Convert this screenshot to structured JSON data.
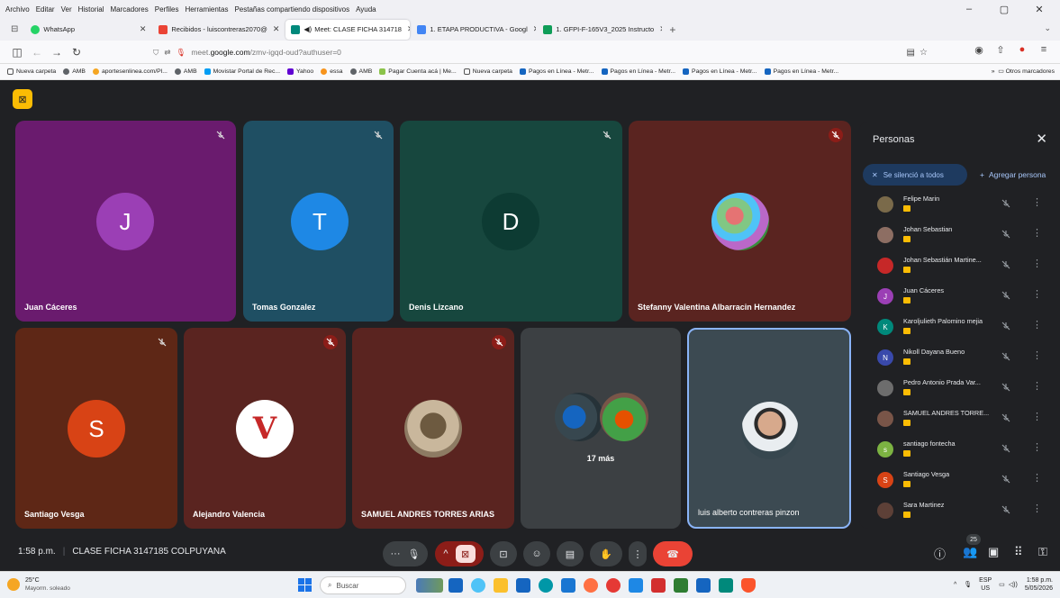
{
  "menubar": [
    "Archivo",
    "Editar",
    "Ver",
    "Historial",
    "Marcadores",
    "Perfiles",
    "Herramientas",
    "Pestañas compartiendo dispositivos",
    "Ayuda"
  ],
  "tabs": [
    {
      "label": "WhatsApp",
      "icon": "whatsapp-icon",
      "color": "#25d366",
      "active": false
    },
    {
      "label": "Recibidos - luiscontreras2070@",
      "icon": "gmail-icon",
      "color": "#ea4335",
      "active": false
    },
    {
      "label": "Meet: CLASE FICHA 314718",
      "icon": "meet-icon",
      "color": "#00897b",
      "active": true
    },
    {
      "label": "1. ETAPA PRODUCTIVA - Googl",
      "icon": "drive-icon",
      "color": "#4285f4",
      "active": false
    },
    {
      "label": "1. GFPI-F-165V3_2025 Instructo",
      "icon": "sheets-icon",
      "color": "#0f9d58",
      "active": false
    }
  ],
  "url": {
    "prefix": "meet.",
    "host": "google.com",
    "path": "/zmv-igqd-oud?authuser=0"
  },
  "bookmarks": [
    "Nueva carpeta",
    "AMB",
    "aportesenlinea.com/Pl...",
    "AMB",
    "Movistar Portal de Rec...",
    "Yahoo",
    "essa",
    "AMB",
    "Pagar Cuenta acá | Me...",
    "Nueva carpeta",
    "Pagos en Línea - Metr...",
    "Pagos en Línea - Metr...",
    "Pagos en Línea - Metr...",
    "Pagos en Línea - Metr..."
  ],
  "other_bookmarks": "Otros marcadores",
  "tiles": [
    {
      "name": "Juan Cáceres",
      "initial": "J",
      "bg": "#6a1b6e",
      "avatar": "#9b3fb5",
      "muted": true
    },
    {
      "name": "Tomas Gonzalez",
      "initial": "T",
      "bg": "#1f4f63",
      "avatar": "#1e88e5",
      "muted": true
    },
    {
      "name": "Denis Lizcano",
      "initial": "D",
      "bg": "#17473e",
      "avatar": "#0d3b33",
      "muted": true
    },
    {
      "name": "Stefanny Valentina Albarracin Hernandez",
      "initial": "",
      "bg": "#5a2420",
      "avatar": "photo",
      "muted": true
    },
    {
      "name": "Santiago Vesga",
      "initial": "S",
      "bg": "#5e2716",
      "avatar": "#d84315",
      "muted": true
    },
    {
      "name": "Alejandro Valencia",
      "initial": "V",
      "bg": "#5a2420",
      "avatar": "logo",
      "muted": true
    },
    {
      "name": "SAMUEL ANDRES TORRES ARIAS",
      "initial": "",
      "bg": "#5a2420",
      "avatar": "photo",
      "muted": true
    },
    {
      "name": "17 más",
      "initial": "",
      "bg": "#3c4043",
      "avatar": "group",
      "muted": false
    },
    {
      "name": "luis alberto contreras pinzon",
      "initial": "",
      "bg": "#3c4a52",
      "avatar": "photo",
      "muted": false
    }
  ],
  "panel": {
    "title": "Personas",
    "mute_all": "Se silenció a todos",
    "add_people": "Agregar persona",
    "people": [
      {
        "name": "Felipe Marin",
        "initial": "",
        "color": "#7a6a4a"
      },
      {
        "name": "Johan Sebastian",
        "initial": "",
        "color": "#8d6e63"
      },
      {
        "name": "Johan Sebastián Martine...",
        "initial": "",
        "color": "#c62828"
      },
      {
        "name": "Juan Cáceres",
        "initial": "J",
        "color": "#9b3fb5"
      },
      {
        "name": "Karoljulieth Palomino mejia",
        "initial": "K",
        "color": "#00897b"
      },
      {
        "name": "Nikoll Dayana Bueno",
        "initial": "N",
        "color": "#3949ab"
      },
      {
        "name": "Pedro Antonio Prada Var...",
        "initial": "",
        "color": "#6d6d6d"
      },
      {
        "name": "SAMUEL ANDRES TORRE...",
        "initial": "",
        "color": "#795548"
      },
      {
        "name": "santiago fontecha",
        "initial": "s",
        "color": "#7cb342"
      },
      {
        "name": "Santiago Vesga",
        "initial": "S",
        "color": "#d84315"
      },
      {
        "name": "Sara Martinez",
        "initial": "",
        "color": "#5d4037"
      }
    ]
  },
  "meeting": {
    "time": "1:58 p.m.",
    "title": "CLASE FICHA 3147185 COLPUYANA",
    "participants": "25"
  },
  "taskbar": {
    "temp": "25°C",
    "weather": "Mayorm. soleado",
    "search": "Buscar",
    "lang": "ESP",
    "lang2": "US",
    "time": "1:58 p.m.",
    "date": "5/05/2026"
  }
}
